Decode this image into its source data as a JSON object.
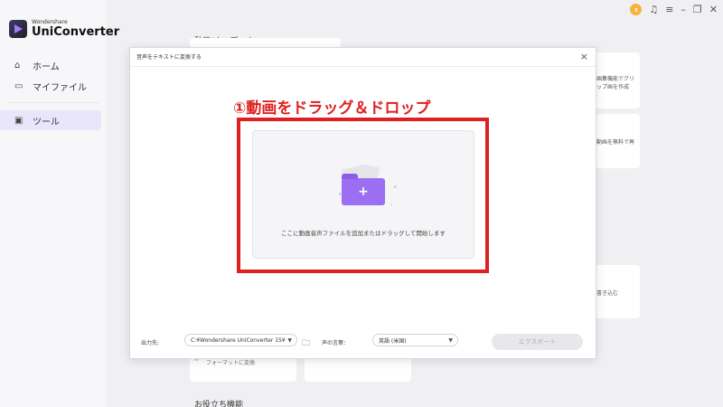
{
  "app": {
    "brand": "Wondershare",
    "product": "UniConverter"
  },
  "sidebar": {
    "items": [
      {
        "label": "ホーム",
        "icon": "home-icon"
      },
      {
        "label": "マイファイル",
        "icon": "folder-icon"
      },
      {
        "label": "ツール",
        "icon": "toolbox-icon",
        "active": true
      }
    ]
  },
  "background": {
    "section_heading": "動画/オーディオ",
    "card_right_1": "画集機能でクリップ画を作成",
    "card_right_2": "動画を無料で再",
    "card_right_3": "書き込む",
    "card_bottom_left": "フォーマットに変換",
    "footer_heading": "お役立ち機能"
  },
  "modal": {
    "title": "音声をテキストに変換する",
    "close_symbol": "×",
    "callout": "①動画をドラッグ＆ドロップ",
    "drop_hint": "ここに動画音声ファイルを追加またはドラッグして開始します",
    "output_label": "出力先:",
    "output_path": "C:¥Wondershare UniConverter 15¥",
    "language_label": "声の言葉：",
    "language_value": "英語 (米国)",
    "export_label": "エクスポート"
  },
  "colors": {
    "accent": "#9b6ef3",
    "highlight": "#e02020",
    "avatar": "#f6b23c"
  }
}
